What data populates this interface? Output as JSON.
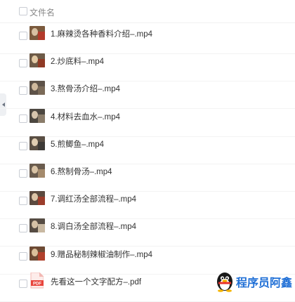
{
  "header": {
    "column_name": "文件名"
  },
  "files": [
    {
      "name": "1.麻辣烫各种香料介绍–.mp4",
      "type": "video",
      "thumb": [
        "#7b5a3d",
        "#d8c0a1",
        "#b23a2a"
      ]
    },
    {
      "name": "2.炒底料–.mp4",
      "type": "video",
      "thumb": [
        "#6e5b48",
        "#e2c9a4",
        "#8f3a25"
      ]
    },
    {
      "name": "3.熬骨汤介绍–.mp4",
      "type": "video",
      "thumb": [
        "#5d5248",
        "#cfb99c",
        "#7a6a58"
      ]
    },
    {
      "name": "4.材料去血水–.mp4",
      "type": "video",
      "thumb": [
        "#4c4740",
        "#d6c5ad",
        "#8a7c6a"
      ]
    },
    {
      "name": "5.煎鲫鱼–.mp4",
      "type": "video",
      "thumb": [
        "#5a4f44",
        "#e0cdb2",
        "#3d3a37"
      ]
    },
    {
      "name": "6.熬制骨汤–.mp4",
      "type": "video",
      "thumb": [
        "#6a5c4e",
        "#d9c3a5",
        "#a48a6c"
      ]
    },
    {
      "name": "7.调红汤全部流程–.mp4",
      "type": "video",
      "thumb": [
        "#5b4a3f",
        "#dcc4a6",
        "#9b3d2b"
      ]
    },
    {
      "name": "8.调白汤全部流程–.mp4",
      "type": "video",
      "thumb": [
        "#564c43",
        "#d5c1a6",
        "#c9b9a2"
      ]
    },
    {
      "name": "9.赠品秘制辣椒油制作–.mp4",
      "type": "video",
      "thumb": [
        "#6d4a34",
        "#dbbf9a",
        "#b0402b"
      ]
    },
    {
      "name": "先看这一个文字配方–.pdf",
      "type": "pdf",
      "icon_label": "PDF"
    }
  ],
  "watermark": {
    "text": "程序员阿鑫",
    "icon": "penguin-icon"
  },
  "colors": {
    "accent": "#1f6fd6",
    "pdf": "#e8453c"
  }
}
